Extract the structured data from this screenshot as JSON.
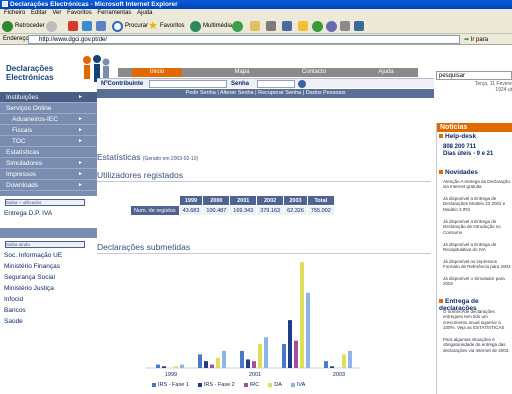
{
  "window": {
    "title": "Declarações Electrónicas - Microsoft Internet Explorer"
  },
  "menu": [
    "Ficheiro",
    "Editar",
    "Ver",
    "Favoritos",
    "Ferramentas",
    "Ajuda"
  ],
  "toolbar": {
    "back": "Retroceder",
    "search": "Procurar",
    "favorites": "Favoritos",
    "media": "Multimédia"
  },
  "address": {
    "label": "Endereço",
    "url": "http://www.dgci.gov.pt/de/",
    "go": "Ir para"
  },
  "site": {
    "logo_line1": "Declarações",
    "logo_line2": "Electrónicas",
    "nav": [
      "Início",
      "Mapa",
      "Contacto",
      "Ajuda"
    ],
    "search_placeholder": "pesquisar",
    "date_line1": "Terça, 11 Fevere",
    "date_line2": "1924 ut",
    "login_nif_label": "NºContribuinte",
    "login_pwd_label": "Senha",
    "links": "Pedir Senha | Alterar Senha | Recuperar Senha | Dados Pessoais"
  },
  "sidebar": {
    "items": [
      {
        "label": "Instituições",
        "arrow": "►"
      },
      {
        "label": "Serviços Online",
        "arrow": ""
      },
      {
        "label": "Aduaneiros-IEC",
        "arrow": "►"
      },
      {
        "label": "Fiscais",
        "arrow": "►"
      },
      {
        "label": "TOC",
        "arrow": "►"
      },
      {
        "label": "Estatísticas",
        "arrow": ""
      },
      {
        "label": "Simuladores",
        "arrow": "►"
      },
      {
        "label": "Impressos",
        "arrow": "►"
      },
      {
        "label": "Downloads",
        "arrow": "►"
      }
    ],
    "box1_title": "Saiba + utilizados",
    "box1_link": "Entrega D.P. IVA",
    "box2_title": "Saiba ainda",
    "box2_links": [
      "Soc. Informação UE",
      "Ministério Finanças",
      "Segurança Social",
      "Ministério Justiça",
      "Infocid",
      "Bancos",
      "Saúde"
    ]
  },
  "main": {
    "title": "Estatísticas",
    "title_note": "(Gerado em 2003-02-10)",
    "section1": "Utilizadores registados",
    "section2": "Declarações submetidas",
    "table": {
      "headers": [
        "1999",
        "2000",
        "2001",
        "2002",
        "2003",
        "Total"
      ],
      "row_label": "Num. de registos",
      "values": [
        "43.683",
        "100.487",
        "169.343",
        "379.163",
        "62.326",
        "755.002"
      ]
    }
  },
  "chart_data": {
    "type": "bar",
    "categories": [
      "1999",
      "2000",
      "2001",
      "2002",
      "2003"
    ],
    "series": [
      {
        "name": "IRS - Fase 1",
        "color": "#4a78c8",
        "values": [
          2,
          8,
          10,
          14,
          4
        ]
      },
      {
        "name": "IRS - Fase 2",
        "color": "#1f3c8a",
        "values": [
          1,
          4,
          5,
          28,
          1
        ]
      },
      {
        "name": "IRC",
        "color": "#a04f9c",
        "values": [
          0,
          2,
          4,
          16,
          0
        ]
      },
      {
        "name": "DA",
        "color": "#dede5a",
        "values": [
          1,
          6,
          14,
          62,
          8
        ]
      },
      {
        "name": "IVA",
        "color": "#8fb5e6",
        "values": [
          2,
          10,
          18,
          44,
          10
        ]
      }
    ]
  },
  "right": {
    "header": "Notícias",
    "helpdesk_title": "Help-desk",
    "helpdesk_phone": "808 200 711",
    "helpdesk_hours": "Dias úteis - 9 e 21",
    "news_title": "Novidades",
    "news": [
      "Atenção A entrega da Declaração via Internet gratuita",
      "Já disponível a Entrega de Declarações Modelo 22 2002 e Modelo 3 IRS",
      "Já disponível a Entrega de Declaração de Introdução no Consumo",
      "Já disponível a Entrega de Recapitulativa do IVA",
      "Já disponível os impressos Formato de Referência para 2003",
      "Já disponível o Simulador para 2002"
    ],
    "section2_title": "Entrega de declarações",
    "section2_items": [
      "O número de declarações entregues tem tido um crescimento anual superior a 100%. Veja as ESTATÍSTICAS",
      "Para algumas situações é obrigatoriedade da entrega das declarações via Internet de 2003."
    ]
  }
}
